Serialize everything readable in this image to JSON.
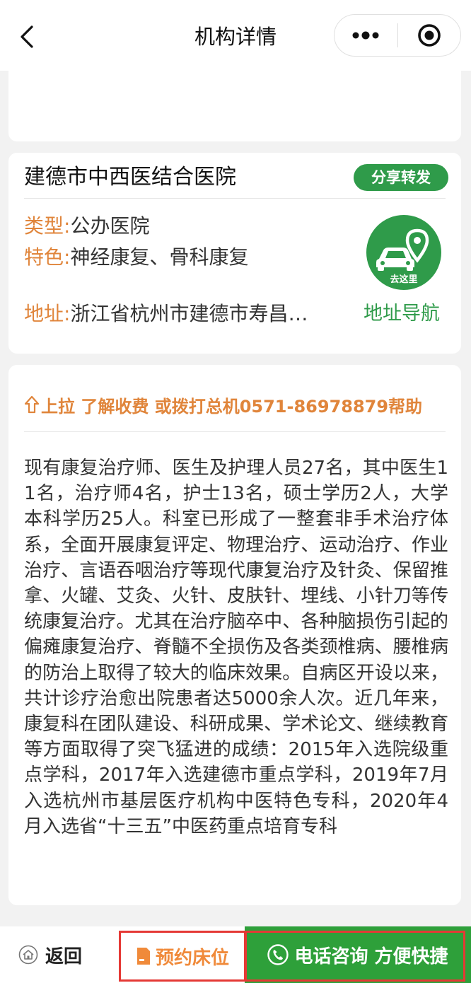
{
  "header": {
    "title": "机构详情",
    "back_icon": "chevron-left-icon",
    "more_icon": "more-dots-icon",
    "close_icon": "target-close-icon"
  },
  "institution": {
    "name": "建德市中西医结合医院",
    "share_label": "分享转发",
    "type_label": "类型:",
    "type_value": "公办医院",
    "feature_label": "特色:",
    "feature_value": "神经康复、骨科康复",
    "address_label": "地址:",
    "address_value": "浙江省杭州市建德市寿昌…",
    "go_label": "去这里",
    "nav_label": "地址导航"
  },
  "description": {
    "hint": "上拉 了解收费 或拨打总机0571-86978879帮助",
    "text": "现有康复治疗师、医生及护理人员27名，其中医生11名，治疗师4名，护士13名，硕士学历2人，大学本科学历25人。科室已形成了一整套非手术治疗体系，全面开展康复评定、物理治疗、运动治疗、作业治疗、言语吞咽治疗等现代康复治疗及针灸、保留推拿、火罐、艾灸、火针、皮肤针、埋线、小针刀等传统康复治疗。尤其在治疗脑卒中、各种脑损伤引起的偏瘫康复治疗、脊髓不全损伤及各类颈椎病、腰椎病的防治上取得了较大的临床效果。自病区开设以来，共计诊疗治愈出院患者达5000余人次。近几年来，康复科在团队建设、科研成果、学术论文、继续教育等方面取得了突飞猛进的成绩：2015年入选院级重点学科，2017年入选建德市重点学科，2019年7月入选杭州市基层医疗机构中医特色专科，2020年4月入选省“十三五”中医药重点培育专科"
  },
  "bottom_bar": {
    "return_label": "返回",
    "reserve_label": "预约床位",
    "call_label": "电话咨询 方便快捷"
  },
  "colors": {
    "green": "#2f9b4a",
    "orange": "#e0853b",
    "highlight_red": "#e53935"
  }
}
